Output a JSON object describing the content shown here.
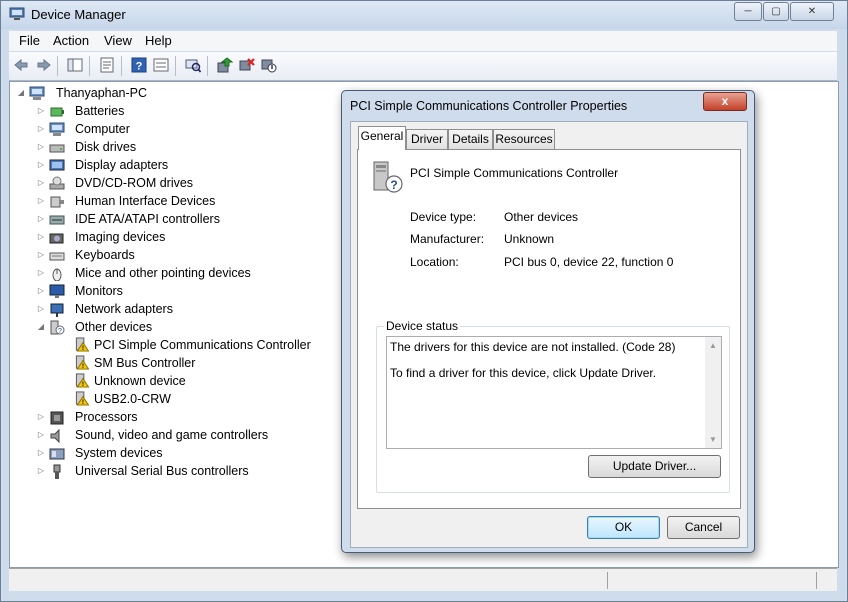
{
  "window": {
    "title": "Device Manager",
    "buttons": [
      "─",
      "▢",
      "✕"
    ]
  },
  "menu": [
    "File",
    "Action",
    "View",
    "Help"
  ],
  "toolbar_icons": [
    "back-icon",
    "forward-icon",
    "show-hide-tree-icon",
    "properties-icon",
    "help-icon",
    "scan-changes-icon",
    "update-driver-icon",
    "uninstall-icon",
    "disable-icon"
  ],
  "tree": {
    "root": "Thanyaphan-PC",
    "categories": [
      {
        "label": "Batteries",
        "icon": "battery-icon"
      },
      {
        "label": "Computer",
        "icon": "computer-icon"
      },
      {
        "label": "Disk drives",
        "icon": "disk-drive-icon"
      },
      {
        "label": "Display adapters",
        "icon": "display-adapter-icon"
      },
      {
        "label": "DVD/CD-ROM drives",
        "icon": "dvd-drive-icon"
      },
      {
        "label": "Human Interface Devices",
        "icon": "hid-icon"
      },
      {
        "label": "IDE ATA/ATAPI controllers",
        "icon": "ide-controller-icon"
      },
      {
        "label": "Imaging devices",
        "icon": "camera-icon"
      },
      {
        "label": "Keyboards",
        "icon": "keyboard-icon"
      },
      {
        "label": "Mice and other pointing devices",
        "icon": "mouse-icon"
      },
      {
        "label": "Monitors",
        "icon": "monitor-icon"
      },
      {
        "label": "Network adapters",
        "icon": "network-adapter-icon"
      },
      {
        "label": "Other devices",
        "icon": "other-devices-icon",
        "expanded": true,
        "children": [
          "PCI Simple Communications Controller",
          "SM Bus Controller",
          "Unknown device",
          "USB2.0-CRW"
        ]
      },
      {
        "label": "Processors",
        "icon": "processor-icon"
      },
      {
        "label": "Sound, video and game controllers",
        "icon": "speaker-icon"
      },
      {
        "label": "System devices",
        "icon": "system-device-icon"
      },
      {
        "label": "Universal Serial Bus controllers",
        "icon": "usb-icon"
      }
    ]
  },
  "dialog": {
    "title": "PCI Simple Communications Controller Properties",
    "close": "x",
    "tabs": [
      "General",
      "Driver",
      "Details",
      "Resources"
    ],
    "device_name": "PCI Simple Communications Controller",
    "info": [
      {
        "label": "Device type:",
        "value": "Other devices"
      },
      {
        "label": "Manufacturer:",
        "value": "Unknown"
      },
      {
        "label": "Location:",
        "value": "PCI bus 0, device 22, function 0"
      }
    ],
    "status_legend": "Device status",
    "status_line1": "The drivers for this device are not installed. (Code 28)",
    "status_line2": "To find a driver for this device, click Update Driver.",
    "update_driver": "Update Driver...",
    "ok": "OK",
    "cancel": "Cancel"
  }
}
